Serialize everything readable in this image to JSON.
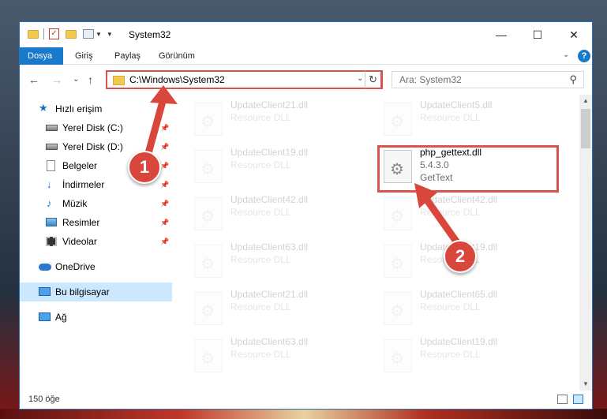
{
  "window": {
    "title": "System32",
    "minimize_glyph": "—",
    "maximize_glyph": "☐",
    "close_glyph": "✕"
  },
  "ribbon": {
    "tabs": [
      "Dosya",
      "Giriş",
      "Paylaş",
      "Görünüm"
    ],
    "active_tab": "Dosya",
    "expand_glyph": "⌄",
    "help_glyph": "?"
  },
  "nav": {
    "back_glyph": "←",
    "forward_glyph": "→",
    "recent_glyph": "⌄",
    "up_glyph": "↑",
    "address": "C:\\Windows\\System32",
    "address_dropdown_glyph": "⌄",
    "refresh_glyph": "↻",
    "search_placeholder": "Ara: System32",
    "search_glyph": "⚲"
  },
  "sidebar": {
    "items": [
      {
        "label": "Hızlı erişim",
        "icon": "star-icon",
        "pinned": false
      },
      {
        "label": "Yerel Disk (C:)",
        "icon": "drive-icon",
        "pinned": true
      },
      {
        "label": "Yerel Disk (D:)",
        "icon": "drive-icon",
        "pinned": true
      },
      {
        "label": "Belgeler",
        "icon": "documents-icon",
        "pinned": true
      },
      {
        "label": "İndirmeler",
        "icon": "downloads-icon",
        "pinned": true
      },
      {
        "label": "Müzik",
        "icon": "music-icon",
        "pinned": true
      },
      {
        "label": "Resimler",
        "icon": "pictures-icon",
        "pinned": true
      },
      {
        "label": "Videolar",
        "icon": "videos-icon",
        "pinned": true
      },
      {
        "label": "OneDrive",
        "icon": "cloud-icon",
        "pinned": false
      },
      {
        "label": "Bu bilgisayar",
        "icon": "computer-icon",
        "pinned": false,
        "selected": true
      },
      {
        "label": "Ağ",
        "icon": "network-icon",
        "pinned": false
      }
    ],
    "pin_glyph": "📌"
  },
  "files": [
    {
      "name": "UpdateClient21.dll",
      "line2": "Resource DLL",
      "line3": "",
      "faded": true
    },
    {
      "name": "UpdateClient5.dll",
      "line2": "Resource DLL",
      "line3": "",
      "faded": true
    },
    {
      "name": "UpdateClient19.dll",
      "line2": "Resource DLL",
      "line3": "",
      "faded": true
    },
    {
      "name": "php_gettext.dll",
      "line2": "5.4.3.0",
      "line3": "GetText",
      "faded": false
    },
    {
      "name": "UpdateClient42.dll",
      "line2": "Resource DLL",
      "line3": "",
      "faded": true
    },
    {
      "name": "UpdateClient42.dll",
      "line2": "Resource DLL",
      "line3": "",
      "faded": true
    },
    {
      "name": "UpdateClient63.dll",
      "line2": "Resource DLL",
      "line3": "",
      "faded": true
    },
    {
      "name": "UpdateClient19.dll",
      "line2": "Resource DLL",
      "line3": "",
      "faded": true
    },
    {
      "name": "UpdateClient21.dll",
      "line2": "Resource DLL",
      "line3": "",
      "faded": true
    },
    {
      "name": "UpdateClient65.dll",
      "line2": "Resource DLL",
      "line3": "",
      "faded": true
    },
    {
      "name": "UpdateClient63.dll",
      "line2": "Resource DLL",
      "line3": "",
      "faded": true
    },
    {
      "name": "UpdateClient19.dll",
      "line2": "Resource DLL",
      "line3": "",
      "faded": true
    }
  ],
  "file_icon_glyph": "⚙",
  "status": {
    "count": "150 öğe"
  },
  "annotations": {
    "badge1": "1",
    "badge2": "2",
    "color": "#d9463b"
  },
  "colors": {
    "accent": "#1979ca",
    "highlight": "#d9534f",
    "selected": "#cce8ff"
  }
}
